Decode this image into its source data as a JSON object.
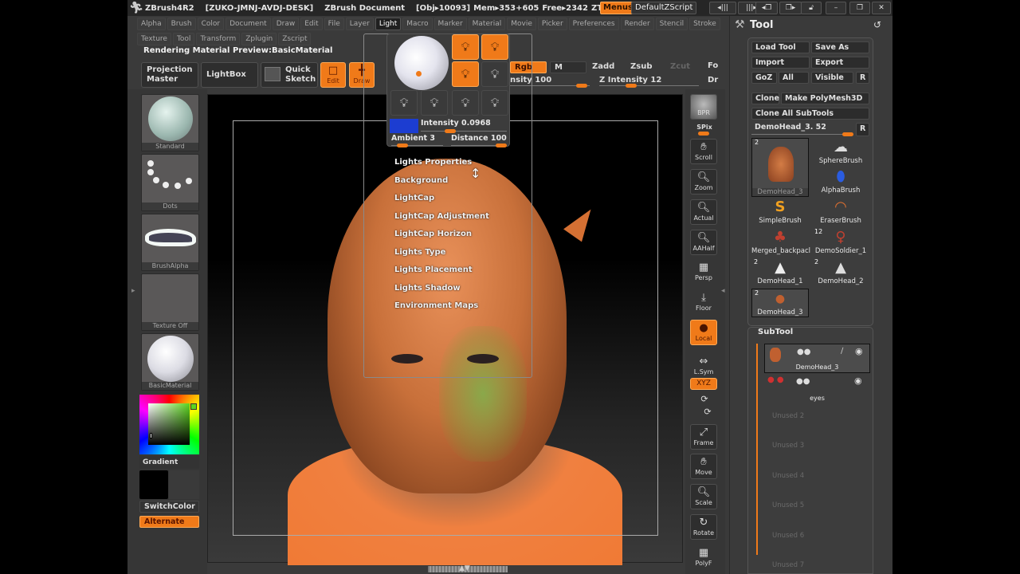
{
  "window": {
    "app_title": "ZBrush4R2",
    "machine_id": "[ZUKO-JMNJ-AVDJ-DESK]",
    "document": "ZBrush Document",
    "obj_info": "[Obj▸10093]",
    "mem_info": "Mem▸353+605",
    "free_info": "Free▸2342",
    "ztime": "ZTim",
    "menus_button": "Menus",
    "zscript_button": "DefaultZScript",
    "icons": [
      "prev-icon",
      "next-icon",
      "restore-layout-icon",
      "store-layout-icon",
      "lock-icon",
      "minimize-icon",
      "maximize-icon",
      "close-icon"
    ]
  },
  "menubar": {
    "row1": [
      "Alpha",
      "Brush",
      "Color",
      "Document",
      "Draw",
      "Edit",
      "File",
      "Layer",
      "Light",
      "Macro",
      "Marker",
      "Material",
      "Movie",
      "Picker",
      "Preferences",
      "Render",
      "Stencil",
      "Stroke"
    ],
    "row2": [
      "Texture",
      "Tool",
      "Transform",
      "Zplugin",
      "Zscript"
    ],
    "active": "Light"
  },
  "status_line": "Rendering Material Preview:BasicMaterial",
  "top_shelf": {
    "projection_master": "Projection Master",
    "lightbox": "LightBox",
    "quick_sketch": "Quick Sketch",
    "edit": "Edit",
    "draw": "Draw",
    "rgb": "Rgb",
    "m": "M",
    "zadd": "Zadd",
    "zsub": "Zsub",
    "zcut": "Zcut",
    "rgb_intensity_label": "nsity",
    "rgb_intensity_value": "100",
    "z_intensity_label": "Z Intensity",
    "z_intensity_value": "12",
    "fo_label": "Fo",
    "dr_label": "Dr"
  },
  "left_shelf": {
    "brush": "Standard",
    "stroke": "Dots",
    "alpha": "BrushAlpha",
    "texture": "Texture Off",
    "material": "BasicMaterial",
    "gradient": "Gradient",
    "switch_color": "SwitchColor",
    "alternate": "Alternate",
    "main_color": "#000000",
    "secondary_color": "#3a3a3a"
  },
  "light_popup": {
    "bulbs_on": [
      true,
      true,
      true,
      false,
      false,
      false,
      false,
      false
    ],
    "light_color": "#1c3dd1",
    "intensity_label": "Intensity",
    "intensity_value": "0.0968",
    "ambient_label": "Ambient",
    "ambient_value": "3",
    "distance_label": "Distance",
    "distance_value": "100",
    "submenus": [
      "Lights Properties",
      "Background",
      "LightCap",
      "LightCap Adjustment",
      "LightCap Horizon",
      "Lights Type",
      "Lights Placement",
      "Lights Shadow",
      "Environment Maps"
    ]
  },
  "right_shelf": {
    "bpr": "BPR",
    "spix": "SPix",
    "scroll": "Scroll",
    "zoom": "Zoom",
    "actual": "Actual",
    "aahalf": "AAHalf",
    "persp": "Persp",
    "floor": "Floor",
    "local": "Local",
    "lsym": "L.Sym",
    "xyz": "XYZ",
    "frame": "Frame",
    "move": "Move",
    "scale": "Scale",
    "rotate": "Rotate",
    "polyf": "PolyF"
  },
  "tool_palette": {
    "title": "Tool",
    "load_tool": "Load Tool",
    "save_as": "Save As",
    "import": "Import",
    "export": "Export",
    "goz": "GoZ",
    "all": "All",
    "visible": "Visible",
    "r": "R",
    "clone": "Clone",
    "make_polymesh": "Make PolyMesh3D",
    "clone_all": "Clone All SubTools",
    "current_tool": "DemoHead_3. 52",
    "tools": [
      {
        "name": "DemoHead_3",
        "count": "2"
      },
      {
        "name": "SphereBrush",
        "count": ""
      },
      {
        "name": "AlphaBrush",
        "count": ""
      },
      {
        "name": "SimpleBrush",
        "count": ""
      },
      {
        "name": "EraserBrush",
        "count": ""
      },
      {
        "name": "Merged_backpacl",
        "count": ""
      },
      {
        "name": "DemoSoldier_1",
        "count": "12"
      },
      {
        "name": "DemoHead_1",
        "count": "2"
      },
      {
        "name": "DemoHead_2",
        "count": "2"
      },
      {
        "name": "DemoHead_3",
        "count": "2"
      }
    ]
  },
  "subtool": {
    "title": "SubTool",
    "items": [
      "DemoHead_3",
      "eyes"
    ],
    "unused": [
      "Unused 2",
      "Unused 3",
      "Unused 4",
      "Unused 5",
      "Unused 6",
      "Unused 7"
    ]
  }
}
